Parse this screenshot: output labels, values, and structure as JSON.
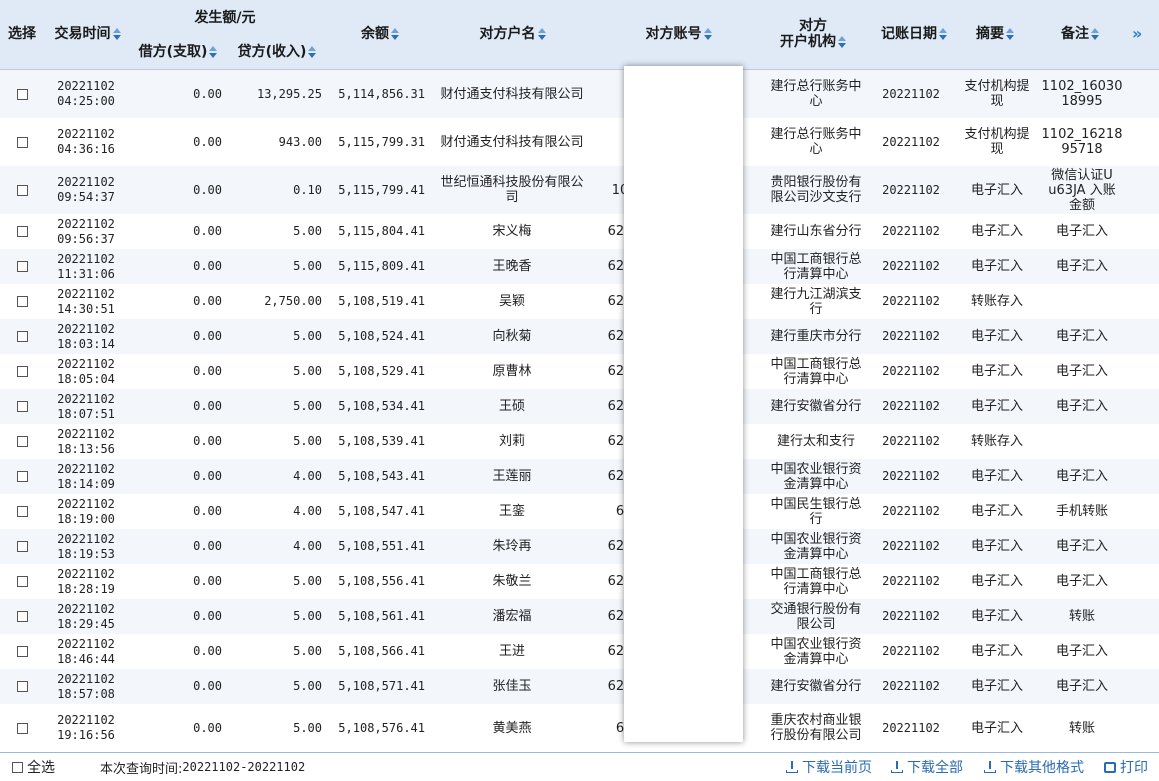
{
  "header": {
    "select": "选择",
    "time": "交易时间",
    "amount_group": "发生额/元",
    "debit": "借方(支取)",
    "credit": "贷方(收入)",
    "balance": "余额",
    "name": "对方户名",
    "account": "对方账号",
    "bank_line1": "对方",
    "bank_line2": "开户机构",
    "post_date": "记账日期",
    "summary": "摘要",
    "remark": "备注",
    "more": "»"
  },
  "rows": [
    {
      "date": "20221102",
      "time": "04:25:00",
      "debit": "0.00",
      "credit": "13,295.25",
      "balance": "5,114,856.31",
      "name": "财付通支付科技有限公司",
      "acct": "",
      "bank": "建行总行账务中心",
      "post": "20221102",
      "summary": "支付机构提现",
      "remark": "1102_16030 18995"
    },
    {
      "date": "20221102",
      "time": "04:36:16",
      "debit": "0.00",
      "credit": "943.00",
      "balance": "5,115,799.31",
      "name": "财付通支付科技有限公司",
      "acct": "",
      "bank": "建行总行账务中心",
      "post": "20221102",
      "summary": "支付机构提现",
      "remark": "1102_16218 95718"
    },
    {
      "date": "20221102",
      "time": "09:54:37",
      "debit": "0.00",
      "credit": "0.10",
      "balance": "5,115,799.41",
      "name": "世纪恒通科技股份有限公司",
      "acct": "10",
      "bank": "贵阳银行股份有限公司沙文支行",
      "post": "20221102",
      "summary": "电子汇入",
      "remark": "微信认证U u63JA 入账金额"
    },
    {
      "date": "20221102",
      "time": "09:56:37",
      "debit": "0.00",
      "credit": "5.00",
      "balance": "5,115,804.41",
      "name": "宋义梅",
      "acct": "621",
      "bank": "建行山东省分行",
      "post": "20221102",
      "summary": "电子汇入",
      "remark": "电子汇入"
    },
    {
      "date": "20221102",
      "time": "11:31:06",
      "debit": "0.00",
      "credit": "5.00",
      "balance": "5,115,809.41",
      "name": "王晚香",
      "acct": "622",
      "bank": "中国工商银行总行清算中心",
      "post": "20221102",
      "summary": "电子汇入",
      "remark": "电子汇入"
    },
    {
      "date": "20221102",
      "time": "14:30:51",
      "debit": "0.00",
      "credit": "2,750.00",
      "balance": "5,108,519.41",
      "name": "吴颖",
      "acct": "623",
      "bank": "建行九江湖滨支行",
      "post": "20221102",
      "summary": "转账存入",
      "remark": ""
    },
    {
      "date": "20221102",
      "time": "18:03:14",
      "debit": "0.00",
      "credit": "5.00",
      "balance": "5,108,524.41",
      "name": "向秋菊",
      "acct": "621",
      "bank": "建行重庆市分行",
      "post": "20221102",
      "summary": "电子汇入",
      "remark": "电子汇入"
    },
    {
      "date": "20221102",
      "time": "18:05:04",
      "debit": "0.00",
      "credit": "5.00",
      "balance": "5,108,529.41",
      "name": "原曹林",
      "acct": "621",
      "bank": "中国工商银行总行清算中心",
      "post": "20221102",
      "summary": "电子汇入",
      "remark": "电子汇入"
    },
    {
      "date": "20221102",
      "time": "18:07:51",
      "debit": "0.00",
      "credit": "5.00",
      "balance": "5,108,534.41",
      "name": "王硕",
      "acct": "622",
      "bank": "建行安徽省分行",
      "post": "20221102",
      "summary": "电子汇入",
      "remark": "电子汇入"
    },
    {
      "date": "20221102",
      "time": "18:13:56",
      "debit": "0.00",
      "credit": "5.00",
      "balance": "5,108,539.41",
      "name": "刘莉",
      "acct": "623",
      "bank": "建行太和支行",
      "post": "20221102",
      "summary": "转账存入",
      "remark": ""
    },
    {
      "date": "20221102",
      "time": "18:14:09",
      "debit": "0.00",
      "credit": "4.00",
      "balance": "5,108,543.41",
      "name": "王莲丽",
      "acct": "621",
      "bank": "中国农业银行资金清算中心",
      "post": "20221102",
      "summary": "电子汇入",
      "remark": "电子汇入"
    },
    {
      "date": "20221102",
      "time": "18:19:00",
      "debit": "0.00",
      "credit": "4.00",
      "balance": "5,108,547.41",
      "name": "王銮",
      "acct": "6",
      "bank": "中国民生银行总行",
      "post": "20221102",
      "summary": "电子汇入",
      "remark": "手机转账"
    },
    {
      "date": "20221102",
      "time": "18:19:53",
      "debit": "0.00",
      "credit": "4.00",
      "balance": "5,108,551.41",
      "name": "朱玲再",
      "acct": "622",
      "bank": "中国农业银行资金清算中心",
      "post": "20221102",
      "summary": "电子汇入",
      "remark": "电子汇入"
    },
    {
      "date": "20221102",
      "time": "18:28:19",
      "debit": "0.00",
      "credit": "5.00",
      "balance": "5,108,556.41",
      "name": "朱敬兰",
      "acct": "621",
      "bank": "中国工商银行总行清算中心",
      "post": "20221102",
      "summary": "电子汇入",
      "remark": "电子汇入"
    },
    {
      "date": "20221102",
      "time": "18:29:45",
      "debit": "0.00",
      "credit": "5.00",
      "balance": "5,108,561.41",
      "name": "潘宏福",
      "acct": "622",
      "bank": "交通银行股份有限公司",
      "post": "20221102",
      "summary": "电子汇入",
      "remark": "转账"
    },
    {
      "date": "20221102",
      "time": "18:46:44",
      "debit": "0.00",
      "credit": "5.00",
      "balance": "5,108,566.41",
      "name": "王进",
      "acct": "622",
      "bank": "中国农业银行资金清算中心",
      "post": "20221102",
      "summary": "电子汇入",
      "remark": "电子汇入"
    },
    {
      "date": "20221102",
      "time": "18:57:08",
      "debit": "0.00",
      "credit": "5.00",
      "balance": "5,108,571.41",
      "name": "张佳玉",
      "acct": "621",
      "bank": "建行安徽省分行",
      "post": "20221102",
      "summary": "电子汇入",
      "remark": "电子汇入"
    },
    {
      "date": "20221102",
      "time": "19:16:56",
      "debit": "0.00",
      "credit": "5.00",
      "balance": "5,108,576.41",
      "name": "黄美燕",
      "acct": "6",
      "bank": "重庆农村商业银行股份有限公司",
      "post": "20221102",
      "summary": "电子汇入",
      "remark": "转账"
    }
  ],
  "footer": {
    "select_all": "全选",
    "query_time_label": "本次查询时间:",
    "query_range": "20221102-20221102",
    "dl_page": "下载当前页",
    "dl_all": "下载全部",
    "dl_other": "下载其他格式",
    "print": "打印"
  },
  "colors": {
    "header_bg": "#dfeaf6",
    "alt_row": "#f3f7fc",
    "link": "#2a6bb5",
    "sort_arrow": "#2f6fb8"
  }
}
